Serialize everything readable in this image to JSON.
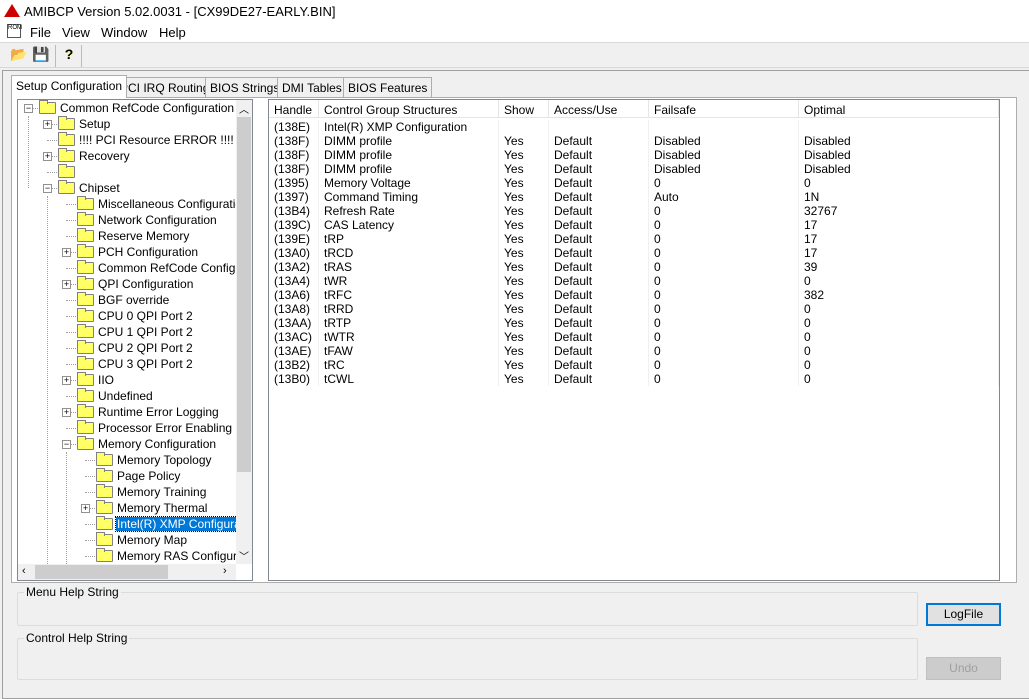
{
  "window": {
    "title": "AMIBCP Version 5.02.0031 - [CX99DE27-EARLY.BIN]",
    "app_icon": "amibcp-logo-icon"
  },
  "menu": [
    "File",
    "View",
    "Window",
    "Help"
  ],
  "toolbar": [
    {
      "icon": "open-folder-icon",
      "label": "Open"
    },
    {
      "icon": "save-disk-icon",
      "label": "Save"
    },
    {
      "icon": "help-question-icon",
      "label": "Help"
    }
  ],
  "tabs": [
    "Setup Configuration",
    "PCI IRQ Routing",
    "BIOS Strings",
    "DMI Tables",
    "BIOS Features"
  ],
  "active_tab": 0,
  "tree": [
    {
      "label": "Common RefCode Configuration",
      "level": 0,
      "exp": "-"
    },
    {
      "label": "Setup",
      "level": 1,
      "exp": "+"
    },
    {
      "label": "!!!! PCI Resource ERROR !!!!",
      "level": 1,
      "exp": ""
    },
    {
      "label": "Recovery",
      "level": 1,
      "exp": "+"
    },
    {
      "label": "",
      "level": 1,
      "exp": ""
    },
    {
      "label": "Chipset",
      "level": 1,
      "exp": "-"
    },
    {
      "label": "Miscellaneous Configuration",
      "level": 2,
      "exp": ""
    },
    {
      "label": "Network Configuration",
      "level": 2,
      "exp": ""
    },
    {
      "label": "Reserve Memory",
      "level": 2,
      "exp": ""
    },
    {
      "label": "PCH Configuration",
      "level": 2,
      "exp": "+"
    },
    {
      "label": "Common RefCode Configurati",
      "level": 2,
      "exp": ""
    },
    {
      "label": "QPI Configuration",
      "level": 2,
      "exp": "+"
    },
    {
      "label": "BGF override",
      "level": 2,
      "exp": ""
    },
    {
      "label": "CPU 0 QPI Port 2",
      "level": 2,
      "exp": ""
    },
    {
      "label": "CPU 1 QPI Port 2",
      "level": 2,
      "exp": ""
    },
    {
      "label": "CPU 2 QPI Port 2",
      "level": 2,
      "exp": ""
    },
    {
      "label": "CPU 3 QPI Port 2",
      "level": 2,
      "exp": ""
    },
    {
      "label": "IIO",
      "level": 2,
      "exp": "+"
    },
    {
      "label": "Undefined",
      "level": 2,
      "exp": ""
    },
    {
      "label": "Runtime Error Logging",
      "level": 2,
      "exp": "+"
    },
    {
      "label": "Processor Error Enabling :",
      "level": 2,
      "exp": ""
    },
    {
      "label": "Memory Configuration",
      "level": 2,
      "exp": "-"
    },
    {
      "label": "Memory Topology",
      "level": 3,
      "exp": ""
    },
    {
      "label": "Page Policy",
      "level": 3,
      "exp": ""
    },
    {
      "label": "Memory Training",
      "level": 3,
      "exp": ""
    },
    {
      "label": "Memory Thermal",
      "level": 3,
      "exp": "+"
    },
    {
      "label": "Intel(R) XMP Configuratio",
      "level": 3,
      "exp": "",
      "selected": true
    },
    {
      "label": "Memory Map",
      "level": 3,
      "exp": ""
    },
    {
      "label": "Memory RAS Configuratio",
      "level": 3,
      "exp": ""
    }
  ],
  "table": {
    "columns": [
      "Handle",
      "Control Group Structures",
      "Show",
      "Access/Use",
      "Failsafe",
      "Optimal"
    ],
    "rows": [
      [
        "(138E)",
        "Intel(R) XMP Configuration",
        "",
        "",
        "",
        ""
      ],
      [
        "(138F)",
        "DIMM profile",
        "Yes",
        "Default",
        "Disabled",
        "Disabled"
      ],
      [
        "(138F)",
        "DIMM profile",
        "Yes",
        "Default",
        "Disabled",
        "Disabled"
      ],
      [
        "(138F)",
        "DIMM profile",
        "Yes",
        "Default",
        "Disabled",
        "Disabled"
      ],
      [
        "(1395)",
        "Memory Voltage",
        "Yes",
        "Default",
        "0",
        "0"
      ],
      [
        "(1397)",
        "Command Timing",
        "Yes",
        "Default",
        "Auto",
        "1N"
      ],
      [
        "(13B4)",
        "Refresh Rate",
        "Yes",
        "Default",
        "0",
        "32767"
      ],
      [
        "(139C)",
        "CAS Latency",
        "Yes",
        "Default",
        "0",
        "17"
      ],
      [
        "(139E)",
        "tRP",
        "Yes",
        "Default",
        "0",
        "17"
      ],
      [
        "(13A0)",
        "tRCD",
        "Yes",
        "Default",
        "0",
        "17"
      ],
      [
        "(13A2)",
        "tRAS",
        "Yes",
        "Default",
        "0",
        "39"
      ],
      [
        "(13A4)",
        "tWR",
        "Yes",
        "Default",
        "0",
        "0"
      ],
      [
        "(13A6)",
        "tRFC",
        "Yes",
        "Default",
        "0",
        "382"
      ],
      [
        "(13A8)",
        "tRRD",
        "Yes",
        "Default",
        "0",
        "0"
      ],
      [
        "(13AA)",
        "tRTP",
        "Yes",
        "Default",
        "0",
        "0"
      ],
      [
        "(13AC)",
        "tWTR",
        "Yes",
        "Default",
        "0",
        "0"
      ],
      [
        "(13AE)",
        "tFAW",
        "Yes",
        "Default",
        "0",
        "0"
      ],
      [
        "(13B2)",
        "tRC",
        "Yes",
        "Default",
        "0",
        "0"
      ],
      [
        "(13B0)",
        "tCWL",
        "Yes",
        "Default",
        "0",
        "0"
      ]
    ]
  },
  "help": {
    "menu_label": "Menu Help String",
    "control_label": "Control Help String"
  },
  "buttons": {
    "logfile": "LogFile",
    "undo": "Undo"
  },
  "colors": {
    "selection": "#0078d7"
  }
}
